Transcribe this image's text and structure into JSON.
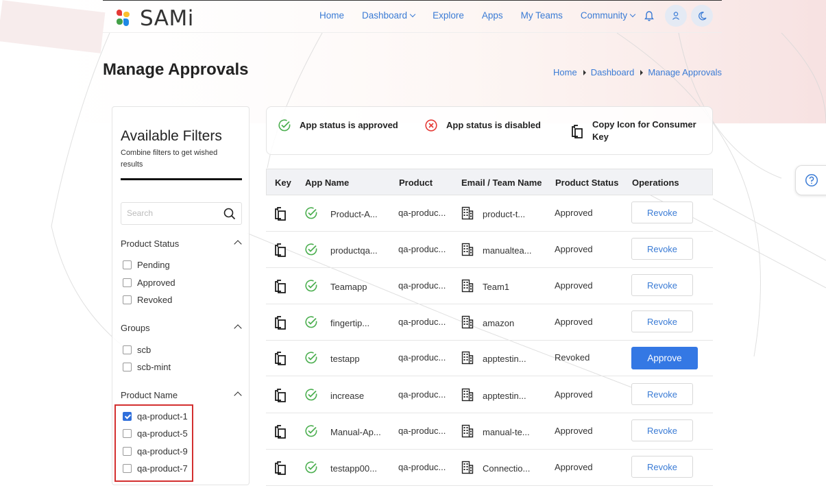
{
  "brand": {
    "name": "SAMi",
    "colors": [
      "#e53935",
      "#fbc02d",
      "#43a047",
      "#1e88e5"
    ]
  },
  "nav": {
    "items": [
      {
        "label": "Home",
        "dropdown": false
      },
      {
        "label": "Dashboard",
        "dropdown": true
      },
      {
        "label": "Explore",
        "dropdown": false
      },
      {
        "label": "Apps",
        "dropdown": false
      },
      {
        "label": "My Teams",
        "dropdown": false
      },
      {
        "label": "Community",
        "dropdown": true
      }
    ],
    "icons": [
      "bell-icon",
      "user-icon",
      "moon-icon"
    ]
  },
  "page": {
    "title": "Manage Approvals"
  },
  "breadcrumb": [
    "Home",
    "Dashboard",
    "Manage Approvals"
  ],
  "filters": {
    "title": "Available Filters",
    "subtitle": "Combine filters to get wished results",
    "search_placeholder": "Search",
    "sections": [
      {
        "title": "Product Status",
        "options": [
          {
            "label": "Pending",
            "checked": false
          },
          {
            "label": "Approved",
            "checked": false
          },
          {
            "label": "Revoked",
            "checked": false
          }
        ]
      },
      {
        "title": "Groups",
        "options": [
          {
            "label": "scb",
            "checked": false
          },
          {
            "label": "scb-mint",
            "checked": false
          }
        ]
      },
      {
        "title": "Product Name",
        "options": [
          {
            "label": "qa-product-1",
            "checked": true
          },
          {
            "label": "qa-product-5",
            "checked": false
          },
          {
            "label": "qa-product-9",
            "checked": false
          },
          {
            "label": "qa-product-7",
            "checked": false
          }
        ]
      }
    ]
  },
  "legend": {
    "approved": "App status is approved",
    "disabled": "App status is disabled",
    "copy": "Copy Icon for Consumer Key"
  },
  "table": {
    "headers": [
      "Key",
      "App Name",
      "Product",
      "Email / Team Name",
      "Product Status",
      "Operations"
    ],
    "rows": [
      {
        "app": "Product-A...",
        "product": "qa-produc...",
        "team": "product-t...",
        "status": "Approved",
        "action": "Revoke"
      },
      {
        "app": "productqa...",
        "product": "qa-produc...",
        "team": "manualtea...",
        "status": "Approved",
        "action": "Revoke"
      },
      {
        "app": "Teamapp",
        "product": "qa-produc...",
        "team": "Team1",
        "status": "Approved",
        "action": "Revoke"
      },
      {
        "app": "fingertip...",
        "product": "qa-produc...",
        "team": "amazon",
        "status": "Approved",
        "action": "Revoke"
      },
      {
        "app": "testapp",
        "product": "qa-produc...",
        "team": "apptestin...",
        "status": "Revoked",
        "action": "Approve"
      },
      {
        "app": "increase",
        "product": "qa-produc...",
        "team": "apptestin...",
        "status": "Approved",
        "action": "Revoke"
      },
      {
        "app": "Manual-Ap...",
        "product": "qa-produc...",
        "team": "manual-te...",
        "status": "Approved",
        "action": "Revoke"
      },
      {
        "app": "testapp00...",
        "product": "qa-produc...",
        "team": "Connectio...",
        "status": "Approved",
        "action": "Revoke"
      }
    ]
  },
  "colors": {
    "accent": "#3a7bd5",
    "approve_bg": "#3478e4",
    "status_ok": "#4caf50",
    "status_err": "#e53935",
    "highlight": "#d32f2f"
  }
}
